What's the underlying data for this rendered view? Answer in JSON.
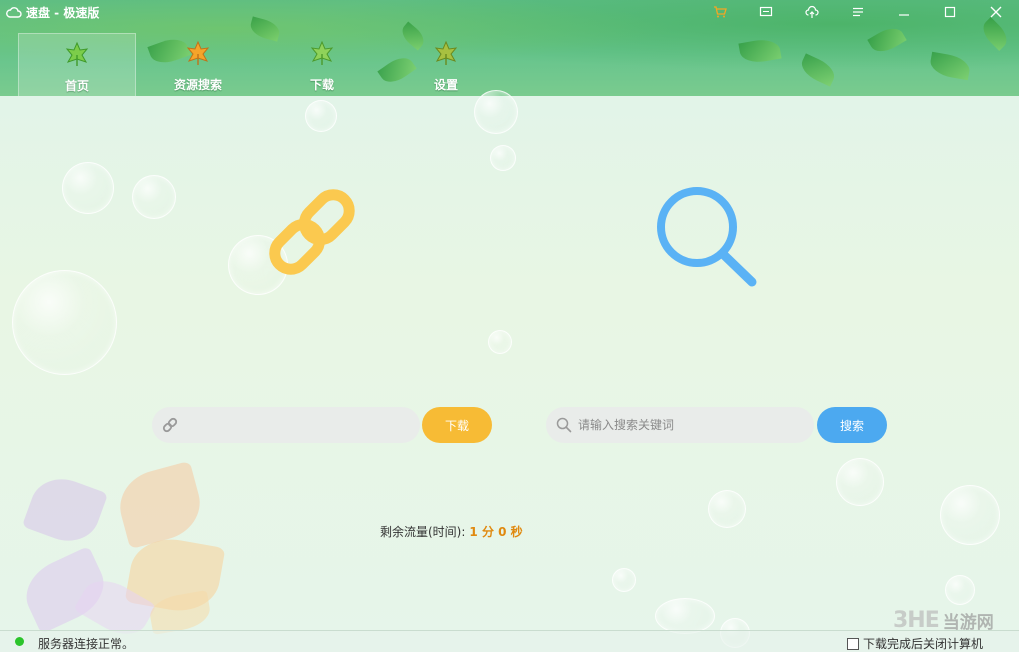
{
  "window": {
    "title": "速盘 - 极速版"
  },
  "nav": {
    "items": [
      {
        "label": "首页",
        "icon": "leaf-green-icon",
        "active": true
      },
      {
        "label": "资源搜索",
        "icon": "leaf-orange-icon",
        "active": false
      },
      {
        "label": "下载",
        "icon": "leaf-green-icon",
        "active": false
      },
      {
        "label": "设置",
        "icon": "leaf-olive-icon",
        "active": false
      }
    ]
  },
  "toolbar_icons": [
    "cart-icon",
    "message-icon",
    "upload-cloud-icon",
    "menu-icon",
    "minimize-icon",
    "maximize-icon",
    "close-icon"
  ],
  "download": {
    "placeholder": "",
    "button_label": "下载"
  },
  "search": {
    "placeholder": "请输入搜索关键词",
    "button_label": "搜索"
  },
  "quota": {
    "label": "剩余流量(时间):",
    "value": "1 分 0 秒"
  },
  "status": {
    "message": "服务器连接正常。",
    "shutdown_label": "下载完成后关闭计算机"
  },
  "watermark": {
    "logo": "3HE",
    "text": "当游网"
  },
  "colors": {
    "header_green": "#5dbd86",
    "download_button": "#f7bb35",
    "search_button": "#4ca9f0",
    "link_icon": "#fbc94f",
    "search_icon": "#5ab2f5",
    "quota_value": "#e0890f",
    "status_ok": "#2bc42b"
  }
}
